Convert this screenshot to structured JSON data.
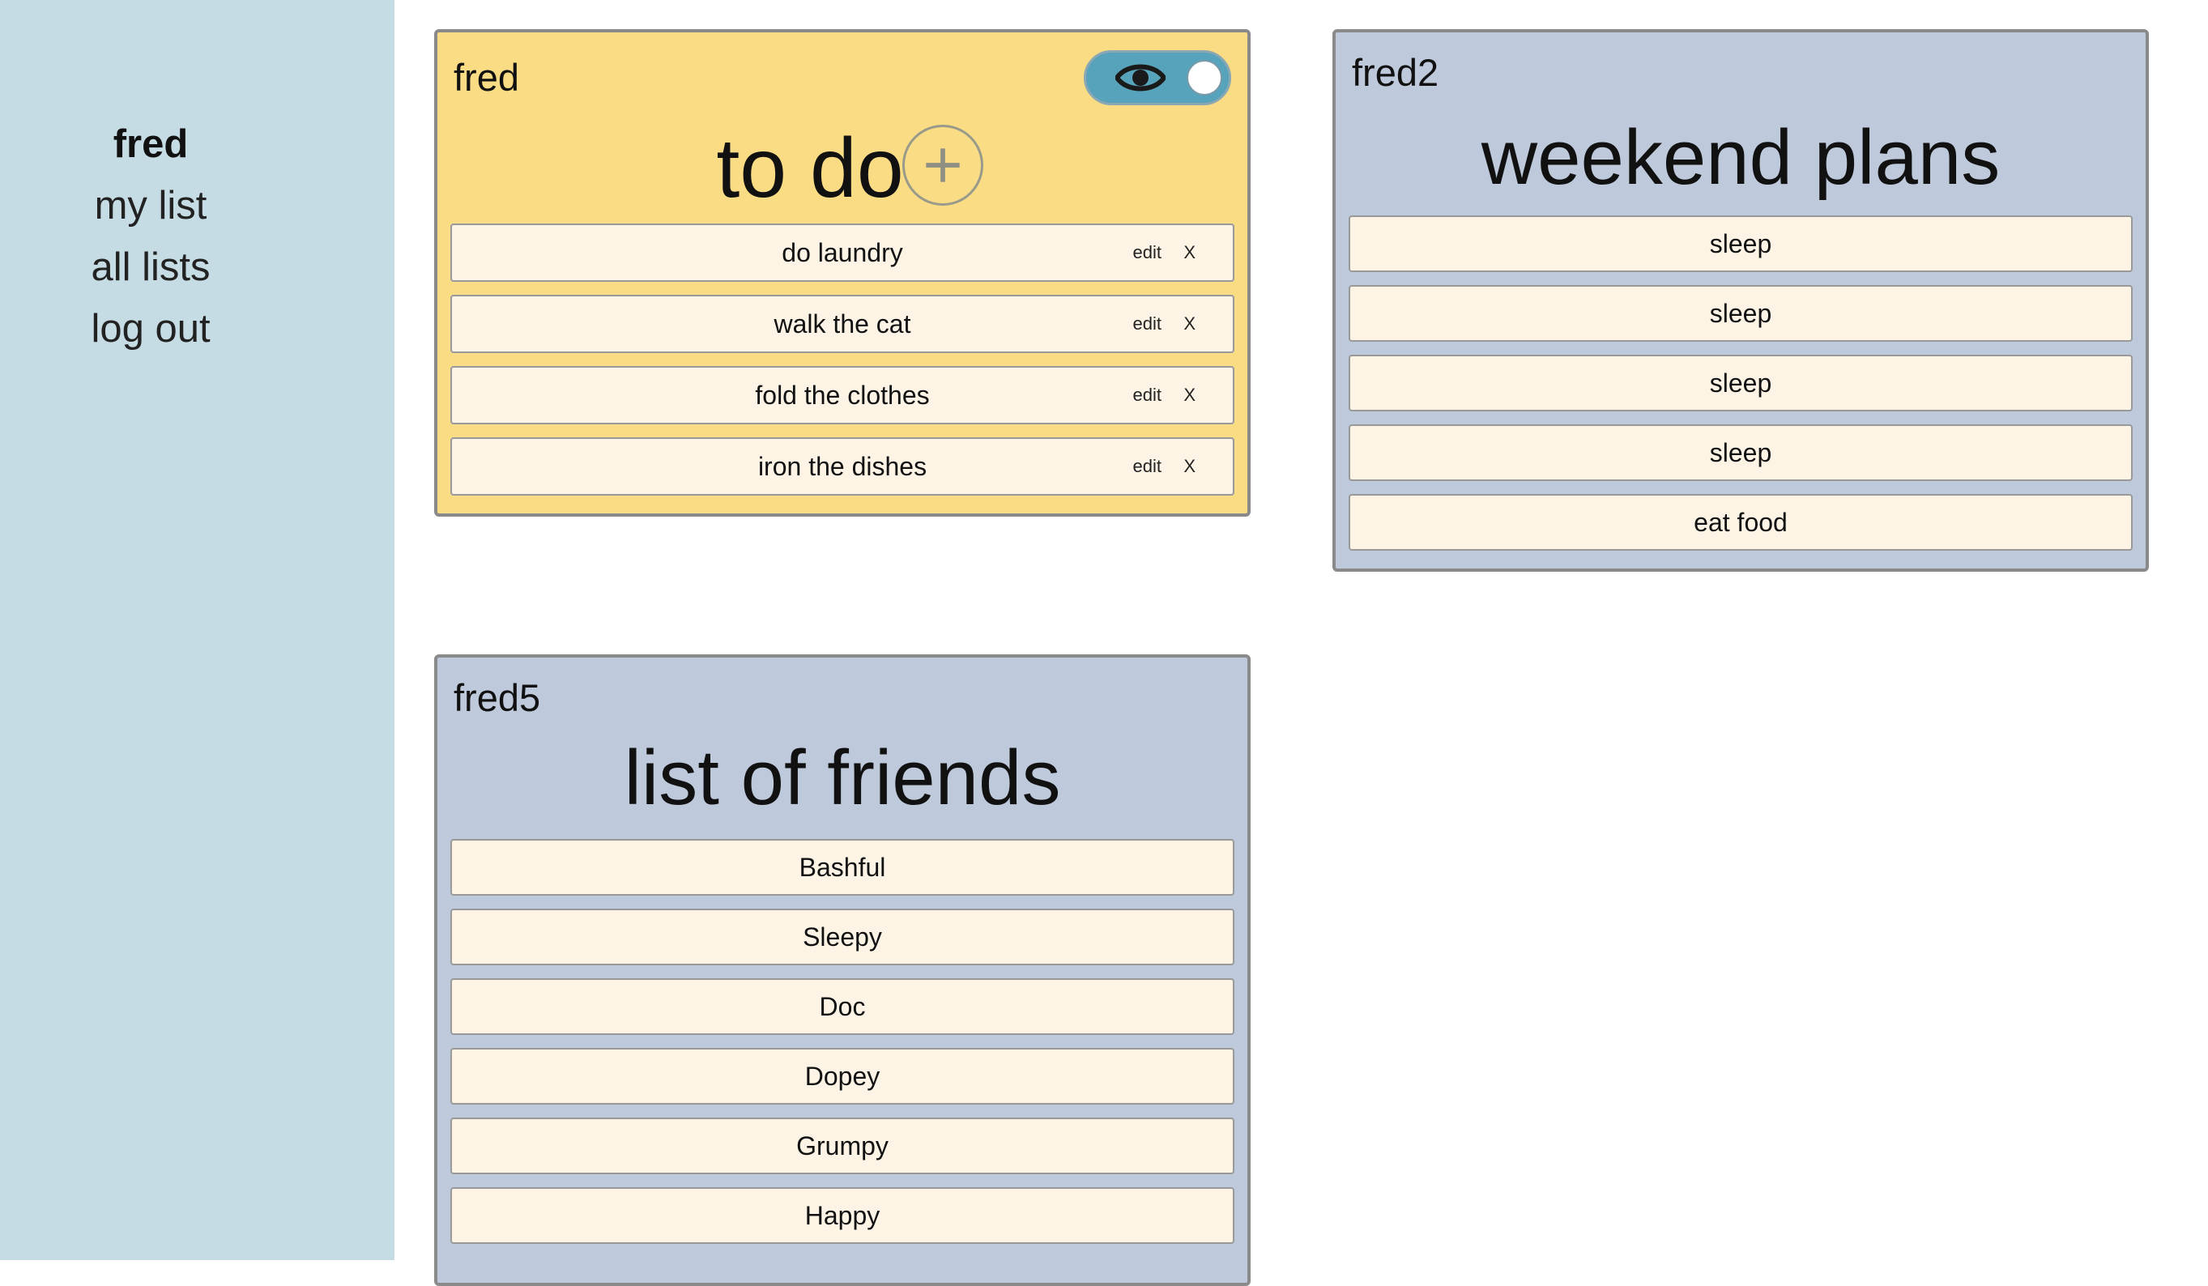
{
  "sidebar": {
    "nav": [
      {
        "label": "fred"
      },
      {
        "label": "my list"
      },
      {
        "label": "all lists"
      },
      {
        "label": "log out"
      }
    ]
  },
  "cards": [
    {
      "owner": "fred",
      "title": "to do",
      "color": "#f9dc84",
      "visibility_icon": "eye-icon",
      "add_icon": "plus-icon",
      "edit_label": "edit",
      "delete_label": "X",
      "items": [
        "do laundry",
        "walk the cat",
        "fold the clothes",
        "iron the dishes"
      ]
    },
    {
      "owner": "fred2",
      "title": "weekend plans",
      "color": "#bec9db",
      "items": [
        "sleep",
        "sleep",
        "sleep",
        "sleep",
        "eat food"
      ]
    },
    {
      "owner": "fred5",
      "title": "list of friends",
      "color": "#bec9db",
      "items": [
        "Bashful",
        "Sleepy",
        "Doc",
        "Dopey",
        "Grumpy",
        "Happy"
      ]
    }
  ]
}
